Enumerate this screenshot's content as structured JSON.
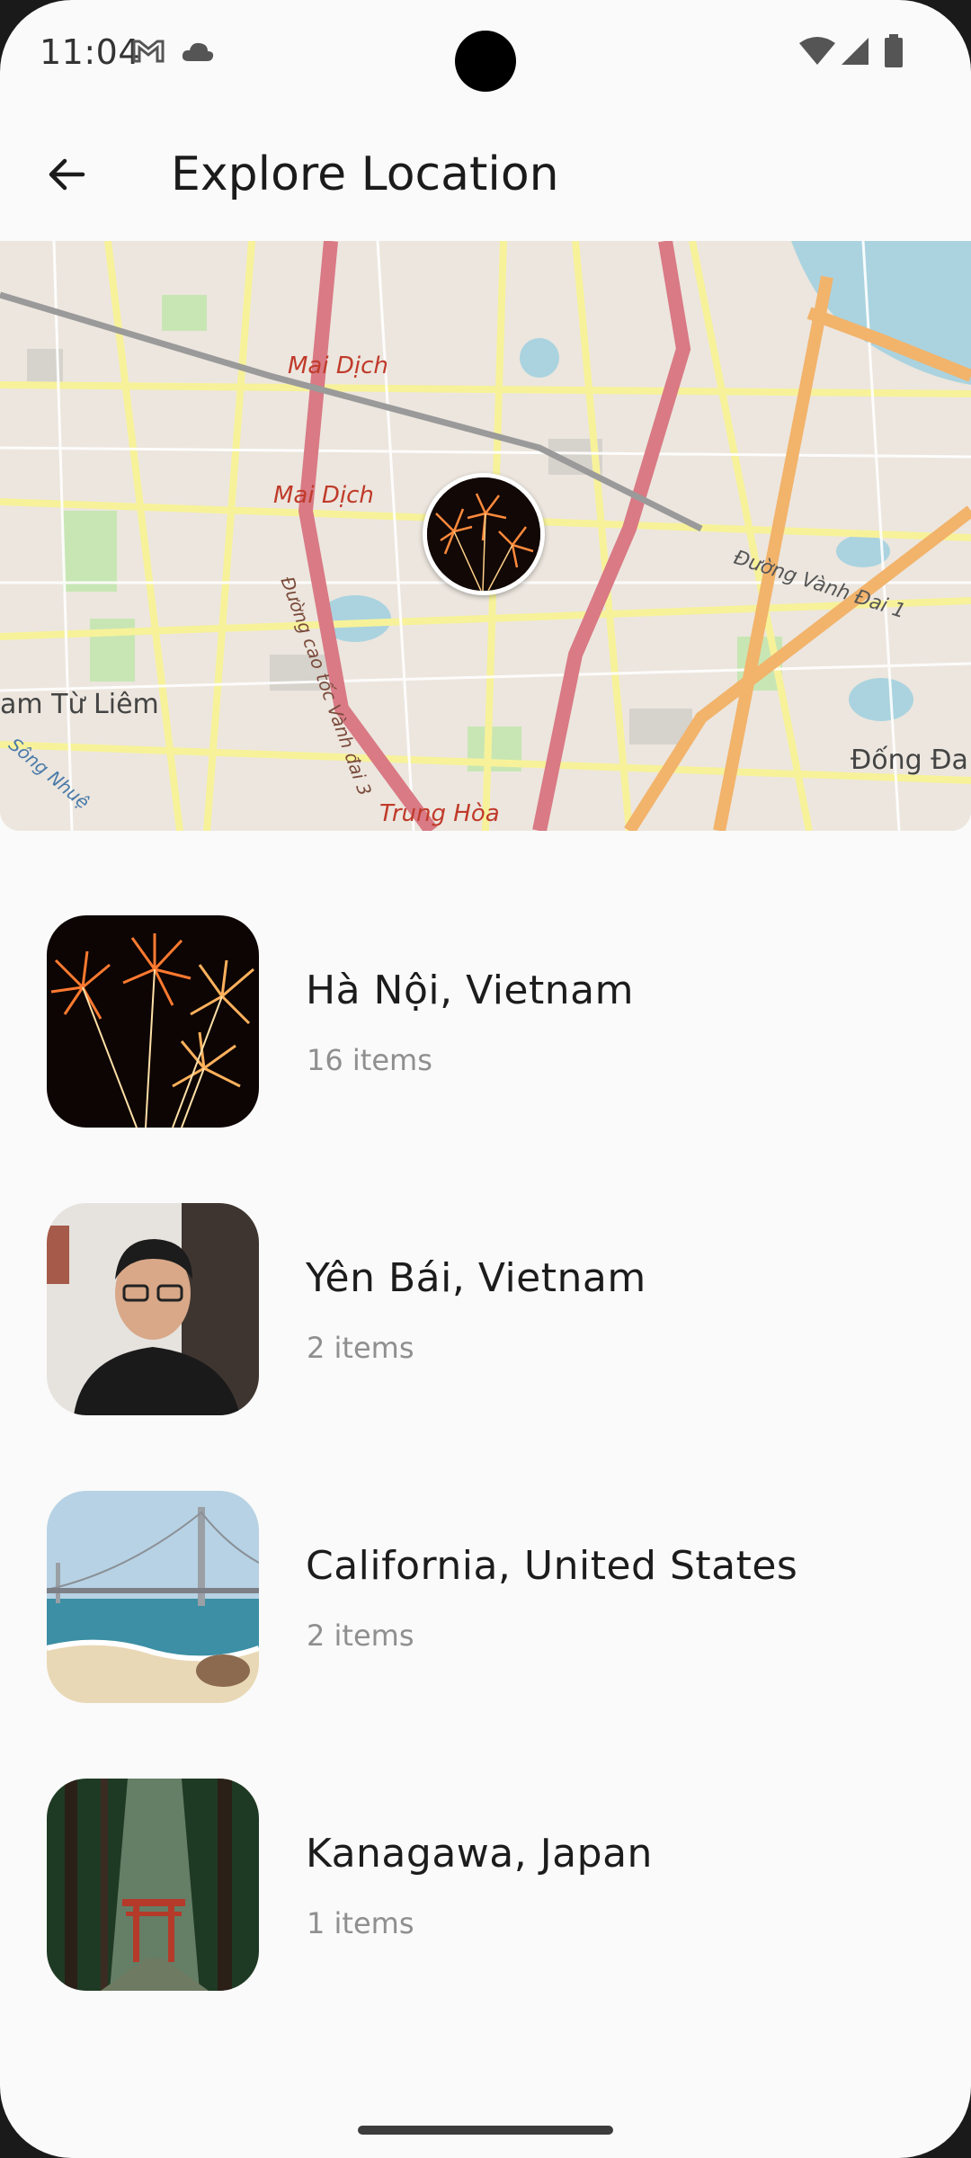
{
  "status_bar": {
    "time": "11:04",
    "icons": [
      "gmail-icon",
      "cloud-icon",
      "wifi-icon",
      "cell-signal-icon",
      "battery-icon"
    ]
  },
  "app_bar": {
    "title": "Explore Location",
    "back_icon": "arrow-back-icon"
  },
  "map": {
    "labels": [
      "Mai Dịch",
      "Mai Dịch",
      "Đường cao tốc Vành đai 3",
      "Đường Vành Đai 1",
      "am Từ Liêm",
      "Sông Nhuệ",
      "Trung Hòa",
      "Đống Đa"
    ]
  },
  "locations": [
    {
      "name": "Hà Nội, Vietnam",
      "count": "16 items",
      "thumb": "fireworks"
    },
    {
      "name": "Yên Bái, Vietnam",
      "count": "2 items",
      "thumb": "portrait"
    },
    {
      "name": "California, United States",
      "count": "2 items",
      "thumb": "bridge-beach"
    },
    {
      "name": "Kanagawa, Japan",
      "count": "1 items",
      "thumb": "forest-torii"
    }
  ],
  "colors": {
    "background": "#fafafa",
    "title_text": "#1b1b1b",
    "secondary_text": "#8f8f8f",
    "map_major_road": "#f2b36b",
    "map_highway": "#d97a85",
    "map_minor_road": "#f5f0a0"
  }
}
